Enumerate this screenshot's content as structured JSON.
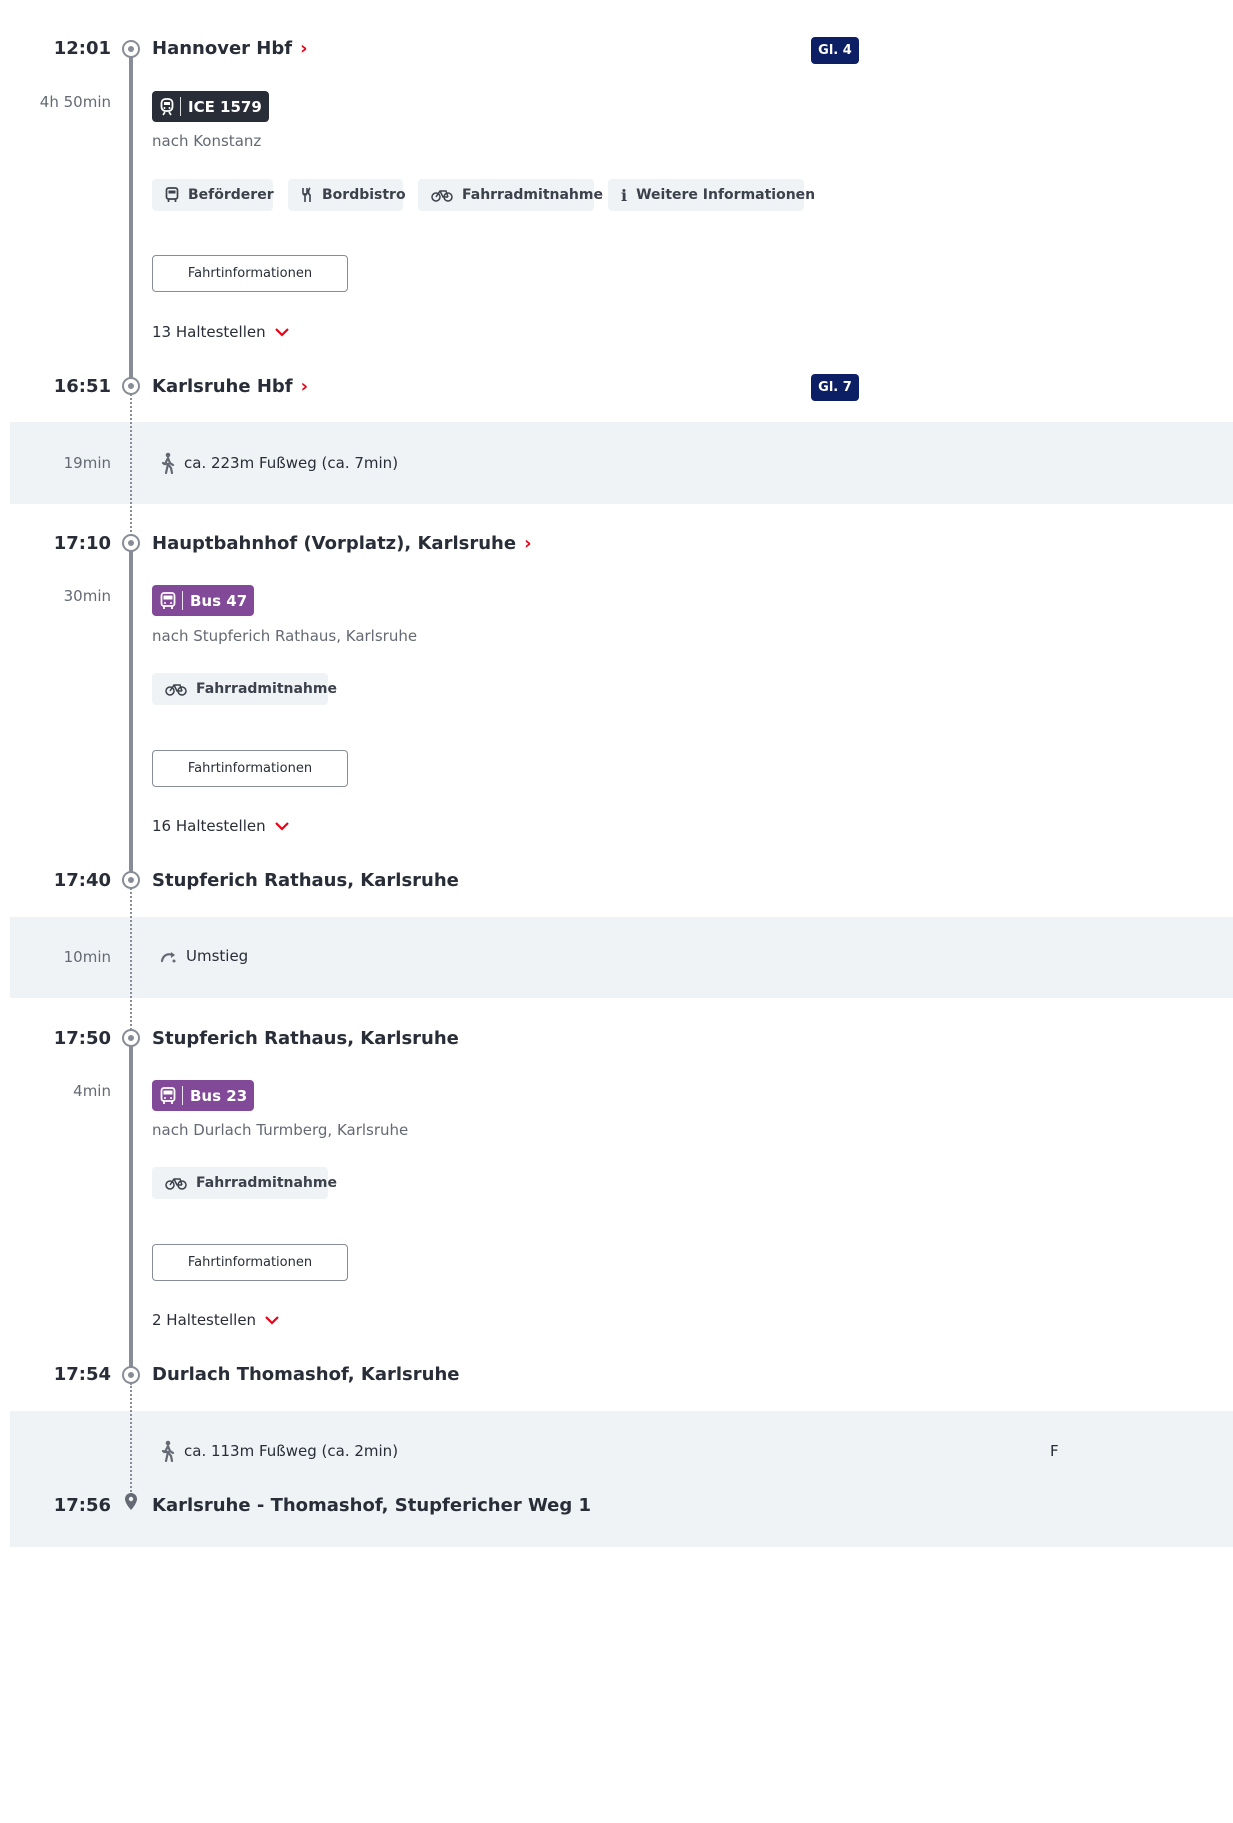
{
  "legs": [
    {
      "dep_time": "12:01",
      "dep_stop": "Hannover Hbf",
      "platform": "Gl. 4",
      "duration": "4h 50min",
      "product": "ICE 1579",
      "direction": "nach Konstanz",
      "chips": [
        "Beförderer",
        "Bordbistro",
        "Fahrradmitnahme",
        "Weitere Informationen"
      ],
      "info_button": "Fahrtinformationen",
      "stops_label": "13 Haltestellen",
      "arr_time": "16:51",
      "arr_stop": "Karlsruhe Hbf",
      "arr_platform": "Gl. 7"
    },
    {
      "dep_time": "17:10",
      "dep_stop": "Hauptbahnhof (Vorplatz), Karlsruhe",
      "duration": "30min",
      "product": "Bus 47",
      "direction": "nach Stupferich Rathaus, Karlsruhe",
      "chips": [
        "Fahrradmitnahme"
      ],
      "info_button": "Fahrtinformationen",
      "stops_label": "16 Haltestellen",
      "arr_time": "17:40",
      "arr_stop": "Stupferich Rathaus, Karlsruhe"
    },
    {
      "dep_time": "17:50",
      "dep_stop": "Stupferich Rathaus, Karlsruhe",
      "duration": "4min",
      "product": "Bus 23",
      "direction": "nach Durlach Turmberg, Karlsruhe",
      "chips": [
        "Fahrradmitnahme"
      ],
      "info_button": "Fahrtinformationen",
      "stops_label": "2 Haltestellen",
      "arr_time": "17:54",
      "arr_stop": "Durlach Thomashof, Karlsruhe"
    }
  ],
  "transfers": [
    {
      "duration": "19min",
      "text": "ca. 223m Fußweg (ca. 7min)",
      "icon": "walk-icon"
    },
    {
      "duration": "10min",
      "text": "Umstieg",
      "icon": "transfer-icon"
    },
    {
      "duration": "",
      "text": "ca. 113m Fußweg (ca. 2min)",
      "icon": "walk-icon"
    }
  ],
  "final": {
    "time": "17:56",
    "stop": "Karlsruhe - Thomashof, Stupfericher Weg 1"
  },
  "truncated_right_text": "F",
  "colors": {
    "accent_red": "#ec0016",
    "platform_bg": "#0c1e64",
    "train_badge": "#282d37",
    "bus_badge": "#814997",
    "band": "#f0f3f5",
    "line": "#878c96"
  }
}
